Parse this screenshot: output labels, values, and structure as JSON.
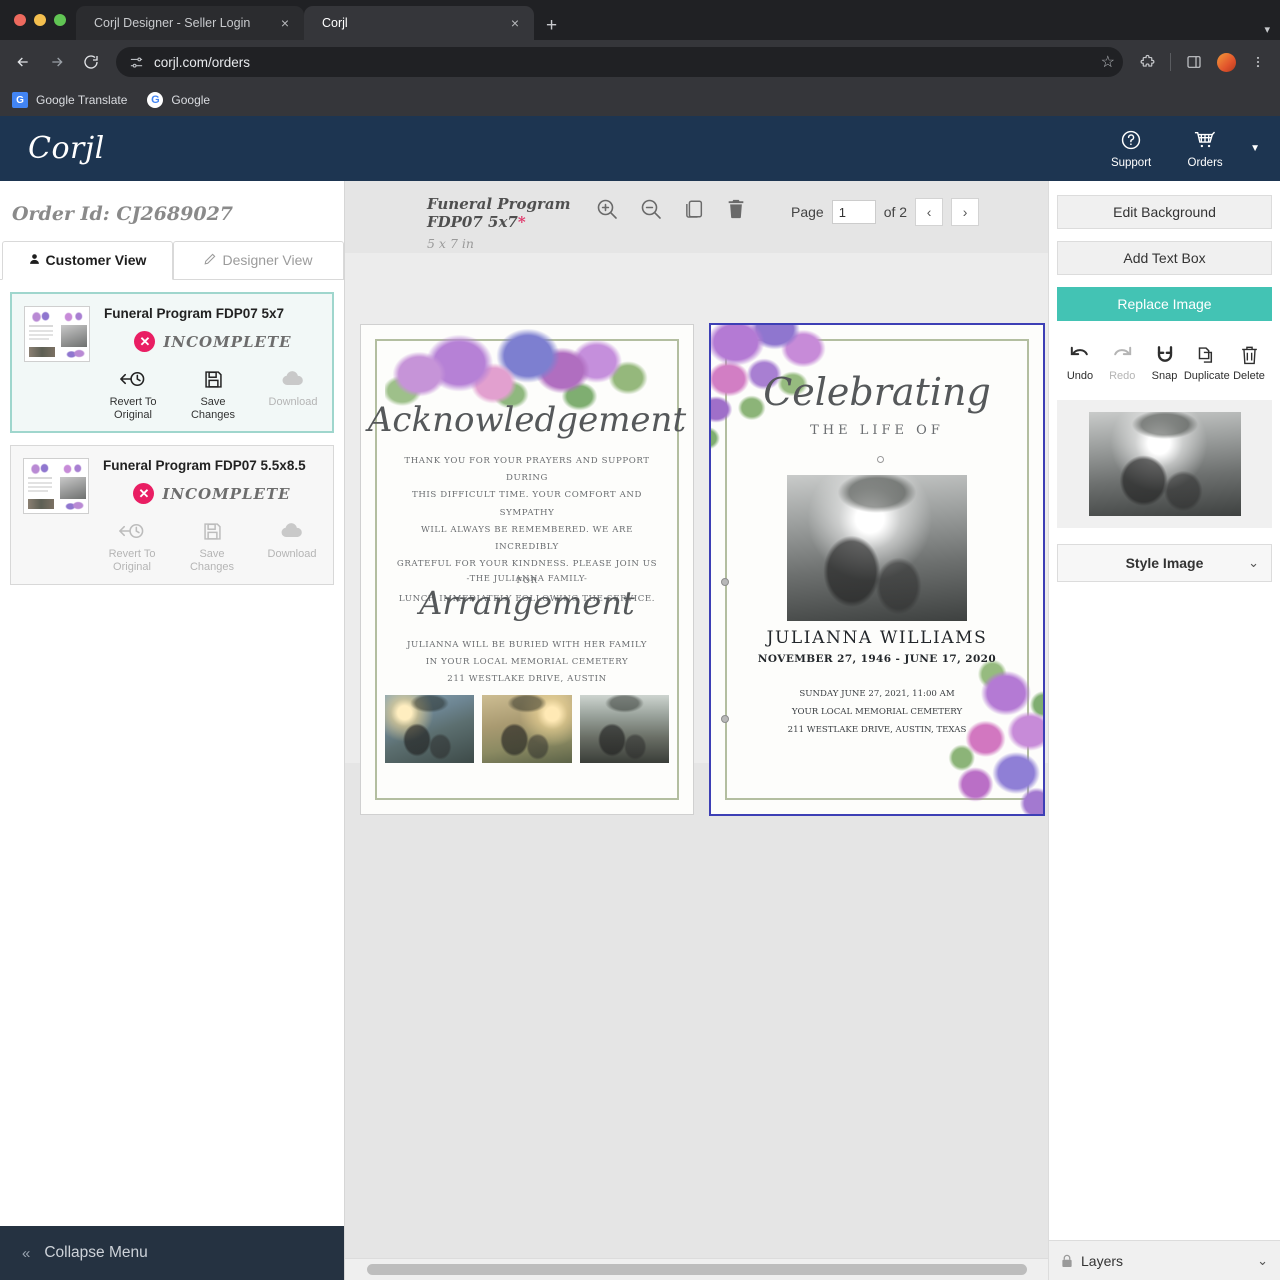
{
  "browser": {
    "tabs": [
      {
        "title": "Corjl Designer - Seller Login",
        "close": "×"
      },
      {
        "title": "Corjl",
        "close": "×"
      }
    ],
    "new_tab_label": "+",
    "tabstrip_caret": "▾",
    "nav": {
      "back": "←",
      "forward": "→",
      "reload": "⟳"
    },
    "url": "corjl.com/orders",
    "star": "☆",
    "bookmarks": [
      {
        "label": "Google Translate",
        "icon_text": "G"
      },
      {
        "label": "Google",
        "icon_text": "G"
      }
    ]
  },
  "appbar": {
    "logo": "Corjl",
    "support_label": "Support",
    "orders_label": "Orders",
    "caret": "▼"
  },
  "sidebar": {
    "order_id": "Order Id: CJ2689027",
    "tabs": [
      {
        "label": "Customer View",
        "selected": true
      },
      {
        "label": "Designer View",
        "selected": false
      }
    ],
    "products": [
      {
        "title": "Funeral Program FDP07 5x7",
        "status": "INCOMPLETE",
        "status_icon": "✕",
        "active": true,
        "actions": [
          {
            "label": "Revert To Original",
            "name": "revert-to-original",
            "disabled": false
          },
          {
            "label": "Save Changes",
            "name": "save-changes",
            "disabled": false
          },
          {
            "label": "Download",
            "name": "download",
            "disabled": true
          }
        ]
      },
      {
        "title": "Funeral Program FDP07 5.5x8.5",
        "status": "INCOMPLETE",
        "status_icon": "✕",
        "active": false,
        "actions": [
          {
            "label": "Revert To Original",
            "name": "revert-to-original",
            "disabled": true
          },
          {
            "label": "Save Changes",
            "name": "save-changes",
            "disabled": true
          },
          {
            "label": "Download",
            "name": "download",
            "disabled": true
          }
        ]
      }
    ],
    "collapse_label": "Collapse Menu",
    "collapse_chevron": "«"
  },
  "canvas_toolbar": {
    "doc_title": "Funeral Program FDP07 5x7",
    "doc_title_asterisk": "*",
    "doc_size": "5 x 7 in",
    "icons": [
      "zoom-in-icon",
      "zoom-out-icon",
      "copy-icon",
      "trash-icon"
    ],
    "page_label": "Page",
    "page_value": "1",
    "of_label": "of 2",
    "prev": "‹",
    "next": "›"
  },
  "pages": {
    "page1": {
      "heading_1": "Acknowledgement",
      "body_lines": [
        "THANK YOU FOR YOUR PRAYERS AND SUPPORT DURING",
        "THIS DIFFICULT TIME. YOUR COMFORT AND SYMPATHY",
        "WILL ALWAYS BE REMEMBERED. WE ARE INCREDIBLY",
        "GRATEFUL FOR YOUR KINDNESS. PLEASE JOIN US FOR",
        "LUNCH IMMEDIATELY FOLLOWING THE SERVICE."
      ],
      "signoff": "-THE JULIANNA FAMILY-",
      "heading_2": "Arrangement",
      "arrangement_lines": [
        "JULIANNA WILL BE BURIED WITH HER FAMILY",
        "IN YOUR LOCAL MEMORIAL CEMETERY",
        "211 WESTLAKE DRIVE, AUSTIN"
      ],
      "photos": [
        "photo-family-sunset",
        "photo-couple-field",
        "photo-walking-path"
      ]
    },
    "page2": {
      "heading_script": "Celebrating",
      "heading_sub": "THE LIFE OF",
      "name": "JULIANNA WILLIAMS",
      "dates": "NOVEMBER 27, 1946 - JUNE 17, 2020",
      "detail_lines": [
        "SUNDAY JUNE 27, 2021, 11:00 AM",
        "YOUR LOCAL MEMORIAL CEMETERY",
        "211 WESTLAKE DRIVE, AUSTIN, TEXAS"
      ],
      "selected": true
    }
  },
  "right_panel": {
    "buttons": [
      {
        "label": "Edit Background",
        "name": "edit-background-button",
        "primary": false
      },
      {
        "label": "Add Text Box",
        "name": "add-text-box-button",
        "primary": false
      },
      {
        "label": "Replace Image",
        "name": "replace-image-button",
        "primary": true
      }
    ],
    "tools": [
      {
        "label": "Undo",
        "name": "undo",
        "disabled": false
      },
      {
        "label": "Redo",
        "name": "redo",
        "disabled": true
      },
      {
        "label": "Snap",
        "name": "snap",
        "disabled": false
      },
      {
        "label": "Duplicate",
        "name": "duplicate",
        "disabled": false
      },
      {
        "label": "Delete",
        "name": "delete",
        "disabled": false
      }
    ],
    "style_image_label": "Style Image",
    "style_image_chevron": "⌄",
    "layers_label": "Layers",
    "layers_chevron": "⌄"
  },
  "colors": {
    "appbar": "#1d3551",
    "accent_teal": "#43c3b4",
    "status_red": "#e91e63",
    "selection_blue": "#3d3fb5",
    "card_active_border": "#9fd6cd"
  }
}
